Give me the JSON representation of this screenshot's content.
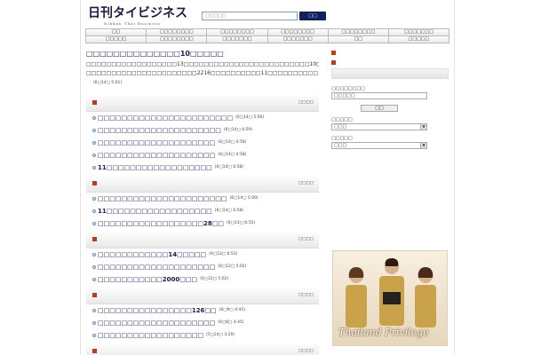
{
  "header": {
    "logo_text": "日刊タイビジネス",
    "logo_sub": "Nikkan Thai Business",
    "search_placeholder": "□□□□□",
    "search_button": "□□"
  },
  "nav": {
    "row1": [
      "□□",
      "□□□□□□□□",
      "□□□□□□□□",
      "□□□□□□□□",
      "□□□□□□□□",
      "□□□□□□□"
    ],
    "row2": [
      "□□□□□",
      "□□□□□□□□",
      "□□□□□□□",
      "□□□□□□□",
      "□□",
      "□□□□□"
    ]
  },
  "featured": {
    "headline": "□□□□□□□□□□□□□□10□□□□□",
    "summary_line1": "□□□□□□□□□□□□□□□□□□13□□□□□□□□□□□□□□□□□□□□□□□□□10□□□□□□□□□□□□□□□□□",
    "summary_line2": "□□□□□□□□□□□□□□□□□□□□□□2216□□□□□□□□□□11□□□□□□□□□□…",
    "date": "(6□14□ 5:01)"
  },
  "sections": [
    {
      "more": "□□□□",
      "items": [
        {
          "title": "□□□□□□□□□□□□□□□□□□□□□□□",
          "date": "(6□14□ 5:00)"
        },
        {
          "title": "□□□□□□□□□□□□□□□□□□□□□",
          "date": "(6□14□ 4:59)"
        },
        {
          "title": "□□□□□□□□□□□□□□□□□□□□",
          "date": "(6□14□ 4:59)"
        },
        {
          "title": "□□□□□□□□□□□□□□□□□□□□",
          "date": "(6□14□ 4:58)"
        },
        {
          "title": "11□□□□□□□□□□□□□□□□□□",
          "date": "(6□14□ 4:58)"
        }
      ]
    },
    {
      "more": "□□□□",
      "items": [
        {
          "title": "□□□□□□□□□□□□□□□□□□□□□□",
          "date": "(6□14□ 5:00)"
        },
        {
          "title": "11□□□□□□□□□□□□□□□□□□",
          "date": "(6□14□ 4:58)"
        },
        {
          "title": "□□□□□□□□□□□□□□□□□□28□□",
          "date": "(6□13□ 6:55)"
        }
      ]
    },
    {
      "more": "□□□□",
      "items": [
        {
          "title": "□□□□□□□□□□□□14□□□□□",
          "date": "(6□13□ 6:53)"
        },
        {
          "title": "□□□□□□□□□□□□□□□□□□□□",
          "date": "(6□12□ 5:02)"
        },
        {
          "title": "□□□□□□□□□□□2000□□□",
          "date": "(6□12□ 5:02)"
        }
      ]
    },
    {
      "more": "□□□□",
      "items": [
        {
          "title": "□□□□□□□□□□□□□□□□126□□",
          "date": "(6□9□ 4:45)"
        },
        {
          "title": "□□□□□□□□□□□□□□□□□□□□",
          "date": "(6□8□ 4:45)"
        },
        {
          "title": "□□□□□□□□□□□□□□□□□□",
          "date": "(5□24□ 3:20)"
        }
      ]
    },
    {
      "more": "□□□□",
      "items": []
    }
  ],
  "sidebar": {
    "field1_label": "□□□□□□□□",
    "field1_value": "□□□□□",
    "button_label": "□□",
    "select1_label": "□□□□□",
    "select1_value": "□□□",
    "select2_label": "□□□□□",
    "select2_value": "□□□",
    "ad_text": "Thailand Privilege"
  }
}
